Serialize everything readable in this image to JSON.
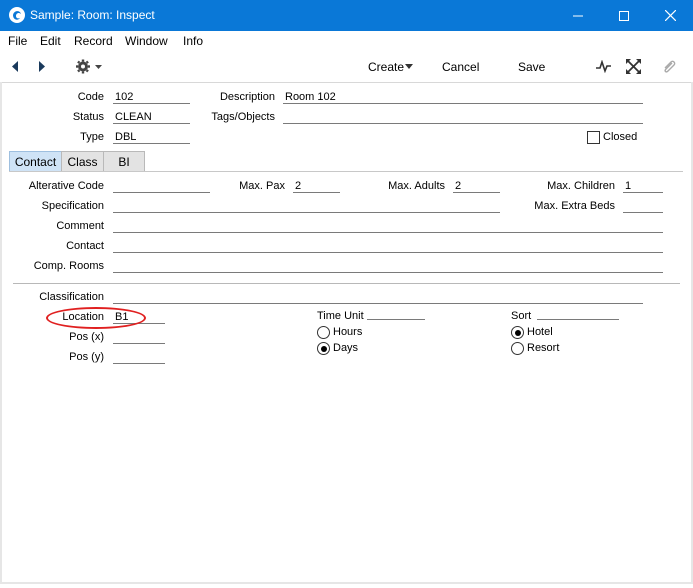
{
  "window": {
    "title": "Sample: Room: Inspect"
  },
  "menubar": {
    "items": [
      "File",
      "Edit",
      "Record",
      "Window",
      "Info"
    ]
  },
  "toolbar": {
    "create_label": "Create",
    "cancel_label": "Cancel",
    "save_label": "Save"
  },
  "header": {
    "code_label": "Code",
    "code_value": "102",
    "status_label": "Status",
    "status_value": "CLEAN",
    "type_label": "Type",
    "type_value": "DBL",
    "description_label": "Description",
    "description_value": "Room 102",
    "tags_label": "Tags/Objects",
    "tags_value": "",
    "closed_label": "Closed",
    "closed_checked": false
  },
  "tabs": [
    {
      "label": "Contact",
      "active": true
    },
    {
      "label": "Class",
      "active": false
    },
    {
      "label": "BI",
      "active": false
    }
  ],
  "contact": {
    "alt_code_label": "Alterative Code",
    "alt_code_value": "",
    "max_pax_label": "Max. Pax",
    "max_pax_value": "2",
    "max_adults_label": "Max. Adults",
    "max_adults_value": "2",
    "max_children_label": "Max. Children",
    "max_children_value": "1",
    "specification_label": "Specification",
    "specification_value": "",
    "max_extra_beds_label": "Max. Extra Beds",
    "max_extra_beds_value": "",
    "comment_label": "Comment",
    "comment_value": "",
    "contact_label": "Contact",
    "contact_value": "",
    "comp_rooms_label": "Comp. Rooms",
    "comp_rooms_value": "",
    "classification_label": "Classification",
    "classification_value": "",
    "location_label": "Location",
    "location_value": "B1",
    "pos_x_label": "Pos (x)",
    "pos_x_value": "",
    "pos_y_label": "Pos (y)",
    "pos_y_value": ""
  },
  "time_unit": {
    "label": "Time Unit",
    "options": [
      "Hours",
      "Days"
    ],
    "selected": "Days"
  },
  "sort": {
    "label": "Sort",
    "options": [
      "Hotel",
      "Resort"
    ],
    "selected": "Hotel"
  },
  "colors": {
    "titlebar": "#0a78d7",
    "highlight": "#e02020",
    "tab_active": "#cfe3f6"
  },
  "icons": [
    "app-icon",
    "minimize-icon",
    "maximize-icon",
    "close-icon",
    "back-arrow-icon",
    "forward-arrow-icon",
    "gear-icon",
    "pulse-icon",
    "expand-icon",
    "paperclip-icon"
  ]
}
